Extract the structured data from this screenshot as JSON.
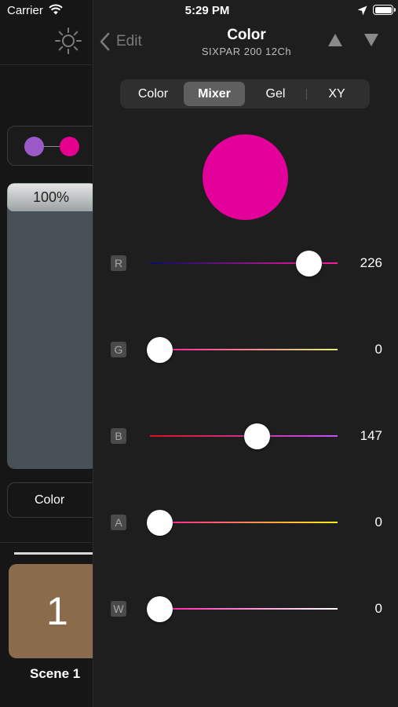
{
  "status": {
    "carrier": "Carrier",
    "time": "5:29 PM"
  },
  "left": {
    "fader_value": "100%",
    "color_button": "Color",
    "scene_number": "1",
    "scene_label": "Scene 1",
    "dot_colors": [
      "#9b59c9",
      "#e5008f"
    ]
  },
  "header": {
    "back_label": "Edit",
    "title": "Color",
    "subtitle": "SIXPAR 200 12Ch"
  },
  "tabs": [
    {
      "label": "Color",
      "active": false
    },
    {
      "label": "Mixer",
      "active": true
    },
    {
      "label": "Gel",
      "active": false
    },
    {
      "label": "XY",
      "active": false
    }
  ],
  "swatch_color": "#e4009a",
  "sliders": [
    {
      "letter": "R",
      "value": "226",
      "level": 0.89,
      "gradient": [
        "#0a0a6a",
        "#ff1aa0"
      ]
    },
    {
      "letter": "G",
      "value": "0",
      "level": 0.0,
      "gradient": [
        "#ff10a0",
        "#e0f07a"
      ]
    },
    {
      "letter": "B",
      "value": "147",
      "level": 0.58,
      "gradient": [
        "#e0101a",
        "#c050ff"
      ]
    },
    {
      "letter": "A",
      "value": "0",
      "level": 0.0,
      "gradient": [
        "#ff10a0",
        "#ffee10"
      ]
    },
    {
      "letter": "W",
      "value": "0",
      "level": 0.0,
      "gradient": [
        "#ff10a0",
        "#ffffff"
      ]
    }
  ]
}
